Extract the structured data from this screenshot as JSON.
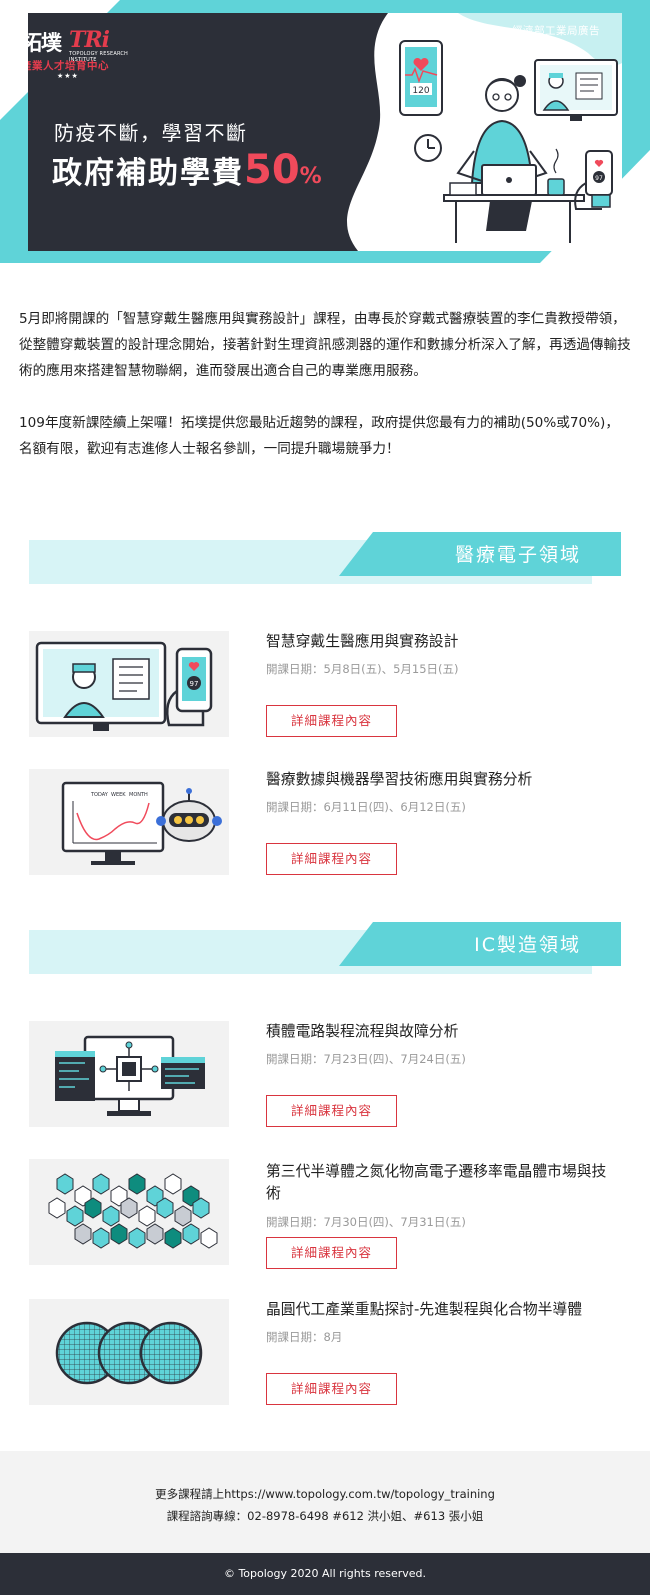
{
  "hero": {
    "sponsor": "經濟部工業局廣告",
    "logo": {
      "main": "拓墣",
      "tri": "TRi",
      "sub": "TOPOLOGY RESEARCH INSTITUTE",
      "center": "產業人才培育中心",
      "stars": "★★★"
    },
    "line1": "防疫不斷，學習不斷",
    "line2_text": "政府補助學費",
    "line2_pct": "50",
    "line2_pct_sign": "%",
    "monitor_reading": "120",
    "phone_reading": "97"
  },
  "intro": {
    "p1": "5月即將開課的「智慧穿戴生醫應用與實務設計」課程，由專長於穿戴式醫療裝置的李仁貴教授帶領，從整體穿戴裝置的設計理念開始，接著針對生理資訊感測器的運作和數據分析深入了解，再透過傳輸技術的應用來搭建智慧物聯網，進而發展出適合自己的專業應用服務。",
    "p2": "109年度新課陸續上架囉！拓墣提供您最貼近趨勢的課程，政府提供您最有力的補助(50%或70%)，名額有限，歡迎有志進修人士報名參訓，一同提升職場競爭力！"
  },
  "sections": [
    {
      "title": "醫療電子領域",
      "courses": [
        {
          "title": "智慧穿戴生醫應用與實務設計",
          "date": "開課日期：5月8日(五)、5月15日(五)",
          "button": "詳細課程內容",
          "image_badge": "97"
        },
        {
          "title": "醫療數據與機器學習技術應用與實務分析",
          "date": "開課日期：6月11日(四)、6月12日(五)",
          "button": "詳細課程內容",
          "image_labels": [
            "TODAY",
            "WEEK",
            "MONTH"
          ]
        }
      ]
    },
    {
      "title": "IC製造領域",
      "courses": [
        {
          "title": "積體電路製程流程與故障分析",
          "date": "開課日期：7月23日(四)、7月24日(五)",
          "button": "詳細課程內容"
        },
        {
          "title": "第三代半導體之氮化物高電子遷移率電晶體市場與技術",
          "date": "開課日期：7月30日(四)、7月31日(五)",
          "button": "詳細課程內容"
        },
        {
          "title": "晶圓代工產業重點探討-先進製程與化合物半導體",
          "date": "開課日期：8月",
          "button": "詳細課程內容"
        }
      ]
    }
  ],
  "footer": {
    "more_courses": "更多課程請上https://www.topology.com.tw/topology_training",
    "contact": "課程諮詢專線：02-8978-6498 #612 洪小姐、#613 張小姐",
    "copyright": "© Topology 2020 All rights reserved."
  },
  "colors": {
    "teal": "#5fd3d8",
    "light_teal": "#d7f4f6",
    "dark": "#2c2f38",
    "accent_red": "#f04a5b",
    "button_red": "#d9353f"
  }
}
